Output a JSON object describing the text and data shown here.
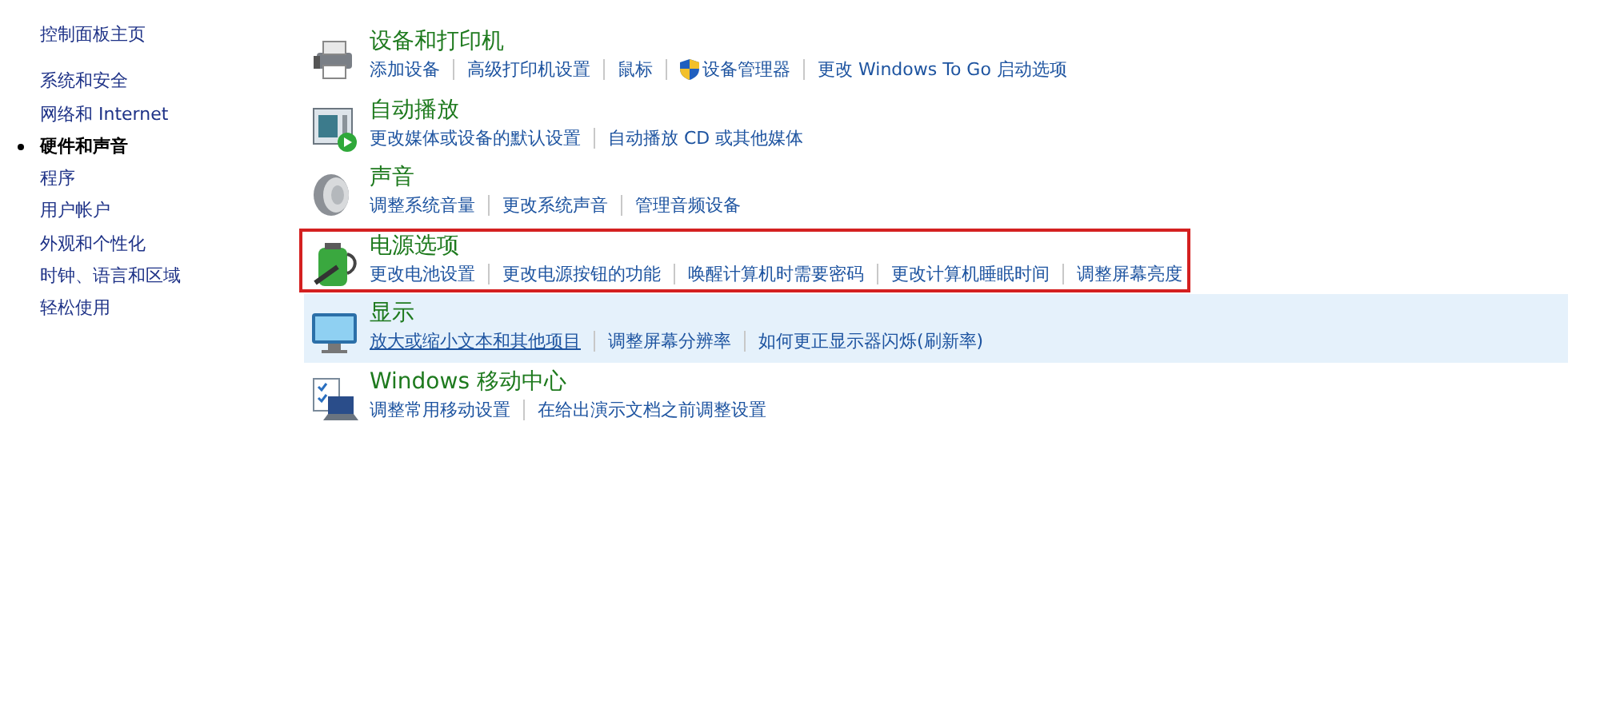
{
  "sidebar": {
    "home": "控制面板主页",
    "items": [
      {
        "label": "系统和安全",
        "selected": false
      },
      {
        "label": "网络和 Internet",
        "selected": false
      },
      {
        "label": "硬件和声音",
        "selected": true
      },
      {
        "label": "程序",
        "selected": false
      },
      {
        "label": "用户帐户",
        "selected": false
      },
      {
        "label": "外观和个性化",
        "selected": false
      },
      {
        "label": "时钟、语言和区域",
        "selected": false
      },
      {
        "label": "轻松使用",
        "selected": false
      }
    ]
  },
  "categories": [
    {
      "title": "设备和打印机",
      "hovered": false,
      "highlighted": false,
      "links": [
        {
          "label": "添加设备",
          "hovered": false
        },
        {
          "label": "高级打印机设置",
          "hovered": false
        },
        {
          "label": "鼠标",
          "hovered": false
        },
        {
          "label": "设备管理器",
          "hovered": false,
          "has_icon": true
        },
        {
          "label": "更改 Windows To Go 启动选项",
          "hovered": false
        }
      ]
    },
    {
      "title": "自动播放",
      "hovered": false,
      "highlighted": false,
      "links": [
        {
          "label": "更改媒体或设备的默认设置",
          "hovered": false
        },
        {
          "label": "自动播放 CD 或其他媒体",
          "hovered": false
        }
      ]
    },
    {
      "title": "声音",
      "hovered": false,
      "highlighted": false,
      "links": [
        {
          "label": "调整系统音量",
          "hovered": false
        },
        {
          "label": "更改系统声音",
          "hovered": false
        },
        {
          "label": "管理音频设备",
          "hovered": false
        }
      ]
    },
    {
      "title": "电源选项",
      "hovered": false,
      "highlighted": true,
      "links": [
        {
          "label": "更改电池设置",
          "hovered": false
        },
        {
          "label": "更改电源按钮的功能",
          "hovered": false
        },
        {
          "label": "唤醒计算机时需要密码",
          "hovered": false
        },
        {
          "label": "更改计算机睡眠时间",
          "hovered": false
        },
        {
          "label": "调整屏幕亮度",
          "hovered": false
        }
      ]
    },
    {
      "title": "显示",
      "hovered": true,
      "highlighted": false,
      "links": [
        {
          "label": "放大或缩小文本和其他项目",
          "hovered": true
        },
        {
          "label": "调整屏幕分辨率",
          "hovered": false
        },
        {
          "label": "如何更正显示器闪烁(刷新率)",
          "hovered": false
        }
      ]
    },
    {
      "title": "Windows 移动中心",
      "hovered": false,
      "highlighted": false,
      "links": [
        {
          "label": "调整常用移动设置",
          "hovered": false
        },
        {
          "label": "在给出演示文档之前调整设置",
          "hovered": false
        }
      ]
    }
  ]
}
